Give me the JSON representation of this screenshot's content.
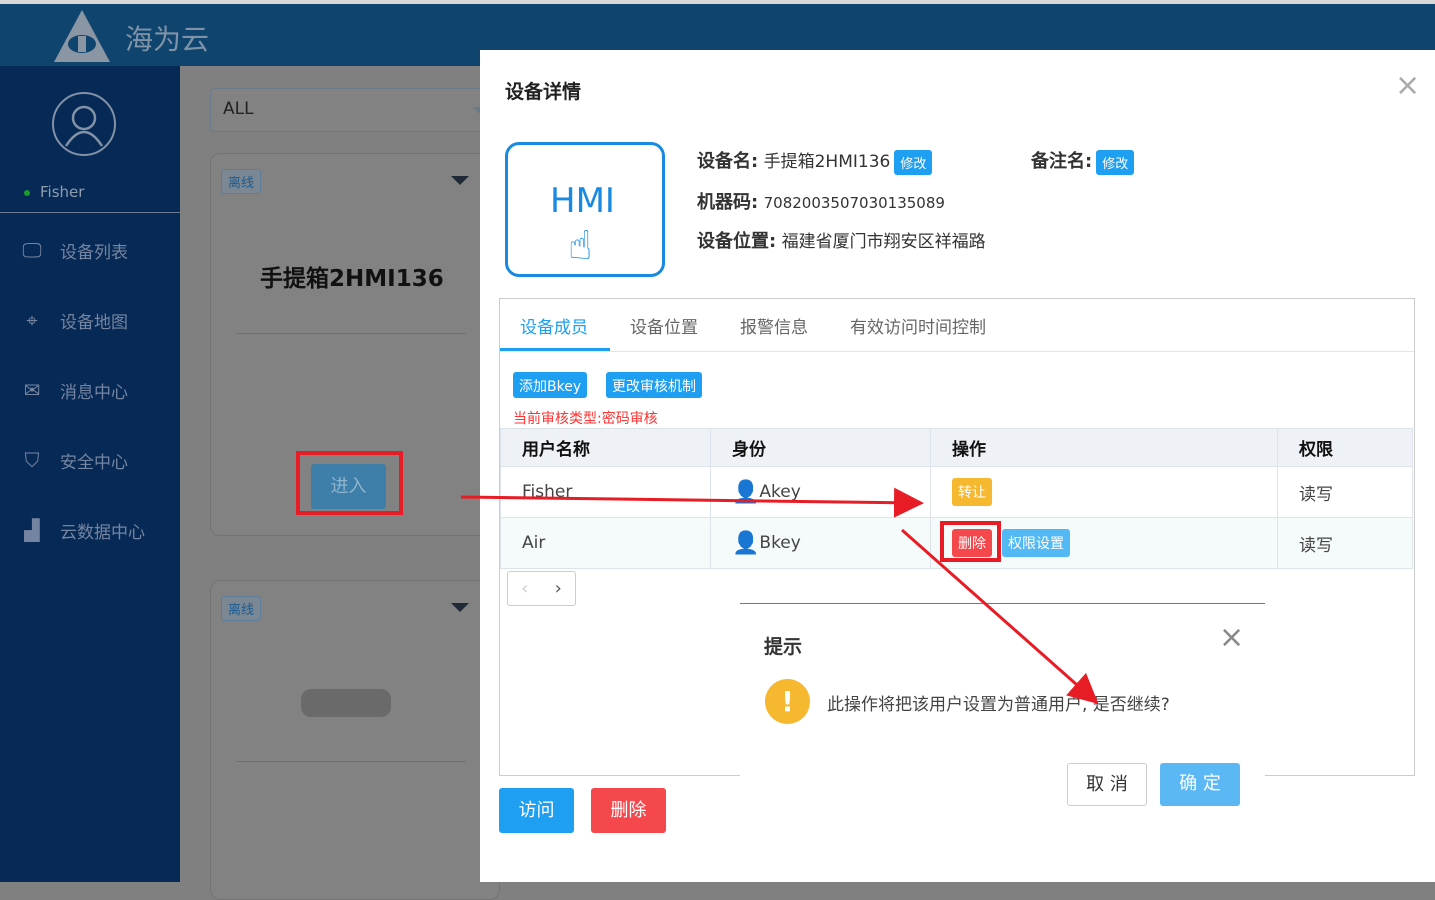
{
  "header": {
    "brand": "海为云"
  },
  "sidebar": {
    "user": "Fisher",
    "items": [
      {
        "label": "设备列表",
        "icon": "monitor-icon"
      },
      {
        "label": "设备地图",
        "icon": "map-pin-icon"
      },
      {
        "label": "消息中心",
        "icon": "mail-icon"
      },
      {
        "label": "安全中心",
        "icon": "shield-icon"
      },
      {
        "label": "云数据中心",
        "icon": "bar-chart-icon"
      }
    ]
  },
  "main": {
    "filter": "ALL",
    "cards": [
      {
        "status": "离线",
        "name": "手提箱2HMI136",
        "enter": "进入"
      },
      {
        "status": "离线"
      }
    ]
  },
  "modal": {
    "title": "设备详情",
    "icon_text": "HMI",
    "device_name_label": "设备名:",
    "device_name": "手提箱2HMI136",
    "edit": "修改",
    "remark_label": "备注名:",
    "machine_code_label": "机器码:",
    "machine_code": "7082003507030135089",
    "location_label": "设备位置:",
    "location": "福建省厦门市翔安区祥福路",
    "tabs": [
      "设备成员",
      "设备位置",
      "报警信息",
      "有效访问时间控制"
    ],
    "add_bkey": "添加Bkey",
    "change_audit": "更改审核机制",
    "audit_type": "当前审核类型:密码审核",
    "table": {
      "headers": [
        "用户名称",
        "身份",
        "操作",
        "权限"
      ],
      "rows": [
        {
          "user": "Fisher",
          "role": "Akey",
          "role_color": "#d9230f",
          "ops": [
            "转让"
          ],
          "perm": "读写"
        },
        {
          "user": "Air",
          "role": "Bkey",
          "role_color": "#1793d9",
          "ops": [
            "删除",
            "权限设置"
          ],
          "perm": "读写"
        }
      ]
    },
    "visit": "访问",
    "delete": "删除"
  },
  "confirm": {
    "title": "提示",
    "message": "此操作将把该用户设置为普通用户, 是否继续?",
    "cancel": "取 消",
    "ok": "确 定"
  },
  "colors": {
    "primary": "#1e9ff2",
    "danger": "#f5484d",
    "warning": "#f5b82e"
  }
}
